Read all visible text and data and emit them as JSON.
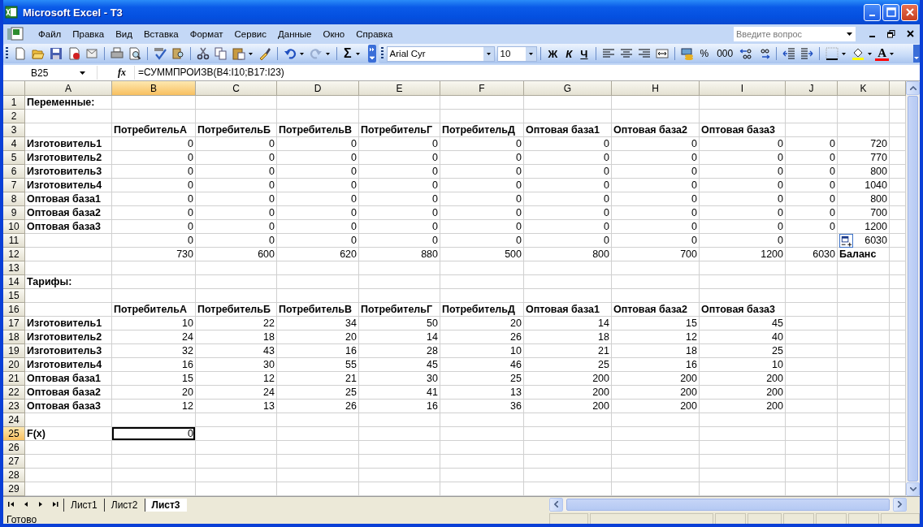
{
  "window": {
    "title": "Microsoft Excel - T3"
  },
  "menu": [
    "Файл",
    "Правка",
    "Вид",
    "Вставка",
    "Формат",
    "Сервис",
    "Данные",
    "Окно",
    "Справка"
  ],
  "help_box": {
    "placeholder": "Введите вопрос"
  },
  "toolbar": {
    "sum": "Σ",
    "font": "Arial Cyr",
    "size": "10",
    "style_buttons": [
      "Ж",
      "К",
      "Ч"
    ],
    "number_buttons": [
      "%",
      "000"
    ],
    "font_color_letter": "A"
  },
  "formula_bar": {
    "name_box": "B25",
    "fx": "fx",
    "formula": "=СУММПРОИЗВ(B4:I10;B17:I23)"
  },
  "columns": [
    {
      "label": "A",
      "selected": false
    },
    {
      "label": "B",
      "selected": true
    },
    {
      "label": "C",
      "selected": false
    },
    {
      "label": "D",
      "selected": false
    },
    {
      "label": "E",
      "selected": false
    },
    {
      "label": "F",
      "selected": false
    },
    {
      "label": "G",
      "selected": false
    },
    {
      "label": "H",
      "selected": false
    },
    {
      "label": "I",
      "selected": false
    },
    {
      "label": "J",
      "selected": false
    },
    {
      "label": "K",
      "selected": false
    }
  ],
  "rows": [
    {
      "label": "1",
      "selected": false,
      "cells": {
        "A": "Переменные:"
      }
    },
    {
      "label": "2",
      "selected": false
    },
    {
      "label": "3",
      "selected": false,
      "header": true,
      "cells": {
        "B": "ПотребительА",
        "C": "ПотребительБ",
        "D": "ПотребительВ",
        "E": "ПотребительГ",
        "F": "ПотребительД",
        "G": "Оптовая база1",
        "H": "Оптовая база2",
        "I": "Оптовая база3"
      }
    },
    {
      "label": "4",
      "selected": false,
      "cells": {
        "A": "Изготовитель1",
        "B": "0",
        "C": "0",
        "D": "0",
        "E": "0",
        "F": "0",
        "G": "0",
        "H": "0",
        "I": "0",
        "J": "0",
        "K": "720"
      }
    },
    {
      "label": "5",
      "selected": false,
      "cells": {
        "A": "Изготовитель2",
        "B": "0",
        "C": "0",
        "D": "0",
        "E": "0",
        "F": "0",
        "G": "0",
        "H": "0",
        "I": "0",
        "J": "0",
        "K": "770"
      }
    },
    {
      "label": "6",
      "selected": false,
      "cells": {
        "A": "Изготовитель3",
        "B": "0",
        "C": "0",
        "D": "0",
        "E": "0",
        "F": "0",
        "G": "0",
        "H": "0",
        "I": "0",
        "J": "0",
        "K": "800"
      }
    },
    {
      "label": "7",
      "selected": false,
      "cells": {
        "A": "Изготовитель4",
        "B": "0",
        "C": "0",
        "D": "0",
        "E": "0",
        "F": "0",
        "G": "0",
        "H": "0",
        "I": "0",
        "J": "0",
        "K": "1040"
      }
    },
    {
      "label": "8",
      "selected": false,
      "cells": {
        "A": "Оптовая база1",
        "B": "0",
        "C": "0",
        "D": "0",
        "E": "0",
        "F": "0",
        "G": "0",
        "H": "0",
        "I": "0",
        "J": "0",
        "K": "800"
      }
    },
    {
      "label": "9",
      "selected": false,
      "cells": {
        "A": "Оптовая база2",
        "B": "0",
        "C": "0",
        "D": "0",
        "E": "0",
        "F": "0",
        "G": "0",
        "H": "0",
        "I": "0",
        "J": "0",
        "K": "700"
      }
    },
    {
      "label": "10",
      "selected": false,
      "cells": {
        "A": "Оптовая база3",
        "B": "0",
        "C": "0",
        "D": "0",
        "E": "0",
        "F": "0",
        "G": "0",
        "H": "0",
        "I": "0",
        "J": "0",
        "K": "1200"
      }
    },
    {
      "label": "11",
      "selected": false,
      "paste_options": true,
      "cells": {
        "B": "0",
        "C": "0",
        "D": "0",
        "E": "0",
        "F": "0",
        "G": "0",
        "H": "0",
        "I": "0",
        "K": "6030"
      }
    },
    {
      "label": "12",
      "selected": false,
      "cells": {
        "B": "730",
        "C": "600",
        "D": "620",
        "E": "880",
        "F": "500",
        "G": "800",
        "H": "700",
        "I": "1200",
        "J": "6030",
        "K": {
          "text": "Баланс",
          "bold": true
        }
      }
    },
    {
      "label": "13",
      "selected": false
    },
    {
      "label": "14",
      "selected": false,
      "cells": {
        "A": "Тарифы:"
      }
    },
    {
      "label": "15",
      "selected": false
    },
    {
      "label": "16",
      "selected": false,
      "header": true,
      "cells": {
        "B": "ПотребительА",
        "C": "ПотребительБ",
        "D": "ПотребительВ",
        "E": "ПотребительГ",
        "F": "ПотребительД",
        "G": "Оптовая база1",
        "H": "Оптовая база2",
        "I": "Оптовая база3"
      }
    },
    {
      "label": "17",
      "selected": false,
      "cells": {
        "A": "Изготовитель1",
        "B": "10",
        "C": "22",
        "D": "34",
        "E": "50",
        "F": "20",
        "G": "14",
        "H": "15",
        "I": "45"
      }
    },
    {
      "label": "18",
      "selected": false,
      "cells": {
        "A": "Изготовитель2",
        "B": "24",
        "C": "18",
        "D": "20",
        "E": "14",
        "F": "26",
        "G": "18",
        "H": "12",
        "I": "40"
      }
    },
    {
      "label": "19",
      "selected": false,
      "cells": {
        "A": "Изготовитель3",
        "B": "32",
        "C": "43",
        "D": "16",
        "E": "28",
        "F": "10",
        "G": "21",
        "H": "18",
        "I": "25"
      }
    },
    {
      "label": "20",
      "selected": false,
      "cells": {
        "A": "Изготовитель4",
        "B": "16",
        "C": "30",
        "D": "55",
        "E": "45",
        "F": "46",
        "G": "25",
        "H": "16",
        "I": "10"
      }
    },
    {
      "label": "21",
      "selected": false,
      "cells": {
        "A": "Оптовая база1",
        "B": "15",
        "C": "12",
        "D": "21",
        "E": "30",
        "F": "25",
        "G": "200",
        "H": "200",
        "I": "200"
      }
    },
    {
      "label": "22",
      "selected": false,
      "cells": {
        "A": "Оптовая база2",
        "B": "20",
        "C": "24",
        "D": "25",
        "E": "41",
        "F": "13",
        "G": "200",
        "H": "200",
        "I": "200"
      }
    },
    {
      "label": "23",
      "selected": false,
      "cells": {
        "A": "Оптовая база3",
        "B": "12",
        "C": "13",
        "D": "26",
        "E": "16",
        "F": "36",
        "G": "200",
        "H": "200",
        "I": "200"
      }
    },
    {
      "label": "24",
      "selected": false
    },
    {
      "label": "25",
      "selected": true,
      "cells": {
        "A": "F(x)",
        "B": "0"
      }
    },
    {
      "label": "26",
      "selected": false
    },
    {
      "label": "27",
      "selected": false
    },
    {
      "label": "28",
      "selected": false
    },
    {
      "label": "29",
      "selected": false
    }
  ],
  "sheet_tabs": [
    {
      "label": "Лист1",
      "selected": false
    },
    {
      "label": "Лист2",
      "selected": false
    },
    {
      "label": "Лист3",
      "selected": true
    }
  ],
  "status_bar": {
    "text": "Готово"
  }
}
